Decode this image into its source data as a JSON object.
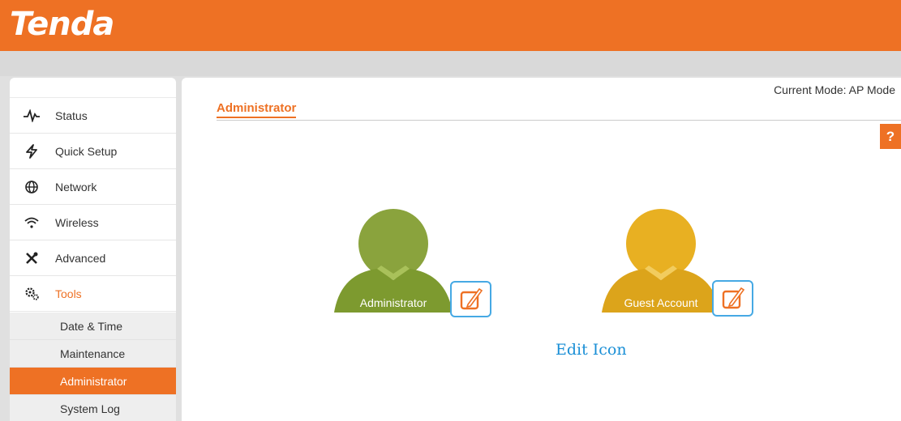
{
  "brand": {
    "logo": "Tenda",
    "color": "#ee7124"
  },
  "header": {
    "mode_text": "Current Mode: AP Mode"
  },
  "sidebar": {
    "items": [
      {
        "label": "Status",
        "icon": "pulse-icon"
      },
      {
        "label": "Quick Setup",
        "icon": "lightning-icon"
      },
      {
        "label": "Network",
        "icon": "globe-icon"
      },
      {
        "label": "Wireless",
        "icon": "wifi-icon"
      },
      {
        "label": "Advanced",
        "icon": "tools-cross-icon"
      },
      {
        "label": "Tools",
        "icon": "gears-icon",
        "active": true
      }
    ],
    "sub_items": [
      {
        "label": "Date & Time"
      },
      {
        "label": "Maintenance"
      },
      {
        "label": "Administrator",
        "active": true
      },
      {
        "label": "System Log"
      }
    ]
  },
  "main": {
    "title": "Administrator",
    "help": "?",
    "accounts": [
      {
        "name": "Administrator",
        "color": "#86a23a",
        "icon": "user-avatar-icon"
      },
      {
        "name": "Guest Account",
        "color": "#e6ad1f",
        "icon": "user-avatar-icon"
      }
    ],
    "edit_icon": "edit-icon",
    "caption": "Edit Icon"
  }
}
